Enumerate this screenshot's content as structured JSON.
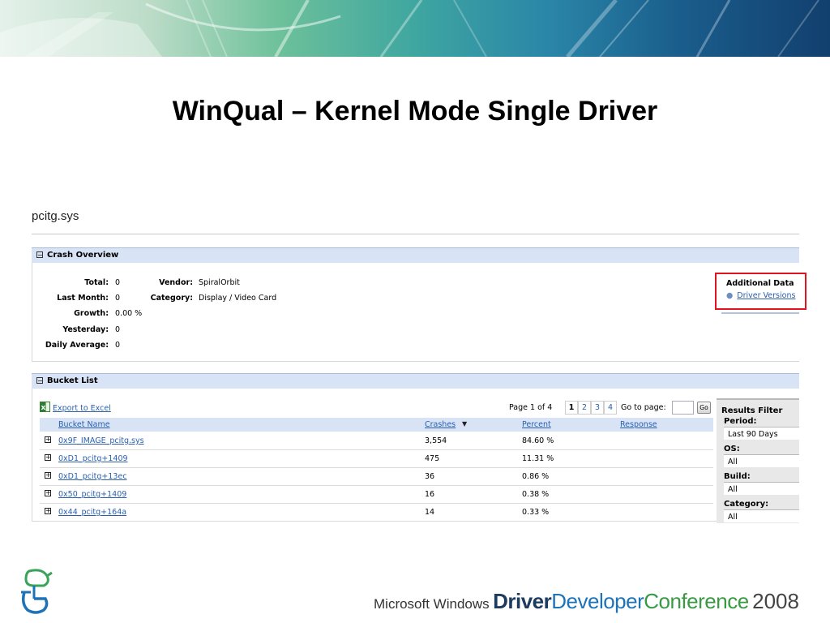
{
  "slide": {
    "title": "WinQual – Kernel Mode Single Driver"
  },
  "page": {
    "driver_name": "pcitg.sys"
  },
  "crash_overview": {
    "header": "Crash Overview",
    "total_label": "Total:",
    "total_value": "0",
    "last_month_label": "Last Month:",
    "last_month_value": "0",
    "growth_label": "Growth:",
    "growth_value": "0.00 %",
    "yesterday_label": "Yesterday:",
    "yesterday_value": "0",
    "daily_average_label": "Daily Average:",
    "daily_average_value": "0",
    "vendor_label": "Vendor:",
    "vendor_value": "SpiralOrbit",
    "category_label": "Category:",
    "category_value": "Display / Video Card"
  },
  "additional_data": {
    "heading": "Additional Data",
    "link": "Driver Versions"
  },
  "bucket_list": {
    "header": "Bucket List",
    "export_label": "Export to Excel",
    "pager": {
      "status": "Page 1 of 4",
      "pages": [
        "1",
        "2",
        "3",
        "4"
      ],
      "current": "1",
      "goto_label": "Go to page:",
      "go_button": "Go"
    },
    "columns": {
      "bucket_name": "Bucket Name",
      "crashes": "Crashes",
      "percent": "Percent",
      "response": "Response"
    },
    "rows": [
      {
        "name": "0x9F_IMAGE_pcitg.sys",
        "crashes": "3,554",
        "percent": "84.60 %",
        "response": ""
      },
      {
        "name": "0xD1_pcitg+1409",
        "crashes": "475",
        "percent": "11.31 %",
        "response": ""
      },
      {
        "name": "0xD1_pcitg+13ec",
        "crashes": "36",
        "percent": "0.86 %",
        "response": ""
      },
      {
        "name": "0x50_pcitg+1409",
        "crashes": "16",
        "percent": "0.38 %",
        "response": ""
      },
      {
        "name": "0x44_pcitg+164a",
        "crashes": "14",
        "percent": "0.33 %",
        "response": ""
      }
    ]
  },
  "results_filter": {
    "title": "Results Filter",
    "period_label": "Period:",
    "period_value": "Last 90 Days",
    "os_label": "OS:",
    "os_value": "All",
    "build_label": "Build:",
    "build_value": "All",
    "category_label": "Category:",
    "category_value": "All"
  },
  "footer": {
    "microsoft_windows": "Microsoft Windows",
    "driver": "Driver",
    "developer": "Developer",
    "conference": "Conference",
    "year": "2008"
  },
  "icons": {
    "collapse": "minus-box-icon",
    "expand": "plus-box-icon",
    "sort": "sort-descending-icon",
    "excel": "excel-icon",
    "bullet": "bullet-icon",
    "logo": "conference-logo-icon"
  },
  "colors": {
    "panel_header": "#d8e3f5",
    "link": "#2a5fb0",
    "highlight_box": "#e0141e",
    "footer_driver": "#1d3b5e",
    "footer_developer": "#1e73b8",
    "footer_conference": "#3a9a44"
  }
}
